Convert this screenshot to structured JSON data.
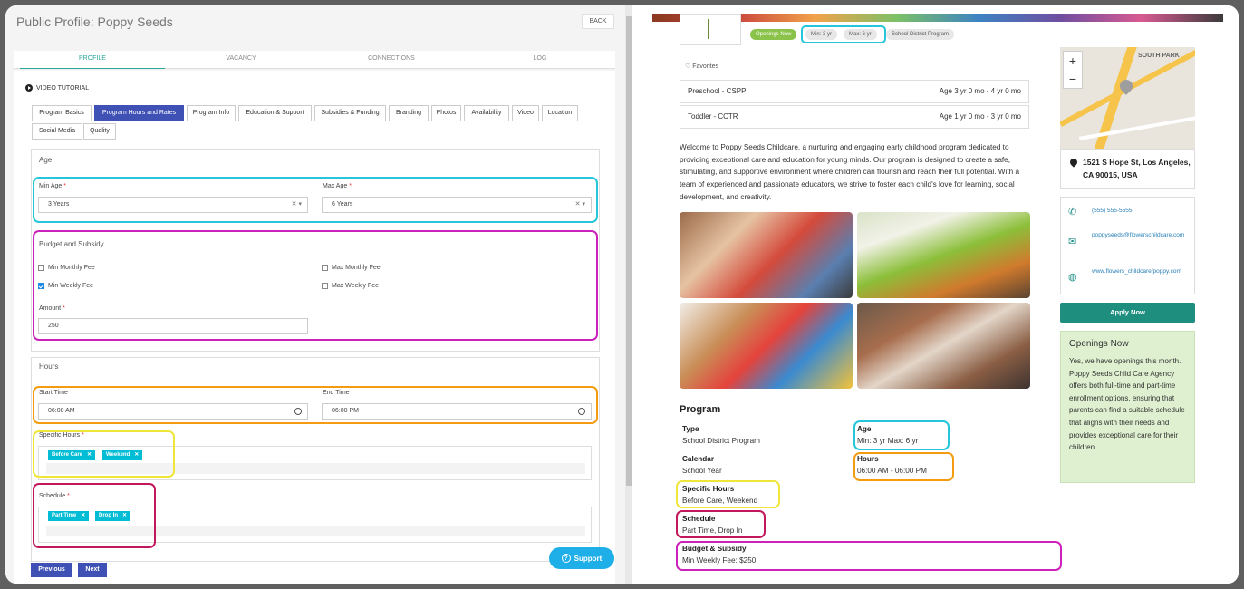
{
  "left": {
    "title": "Public Profile: Poppy Seeds",
    "back_label": "BACK",
    "tabs": [
      "PROFILE",
      "VACANCY",
      "CONNECTIONS",
      "LOG"
    ],
    "video_tutorial": "VIDEO TUTORIAL",
    "subtabs": [
      "Program Basics",
      "Program Hours and Rates",
      "Program Info",
      "Education & Support",
      "Subsidies & Funding",
      "Branding",
      "Photos",
      "Availability",
      "Video",
      "Location",
      "Social Media",
      "Quality"
    ],
    "age": {
      "heading": "Age",
      "min_label": "Min Age",
      "min_value": "3 Years",
      "max_label": "Max Age",
      "max_value": "6 Years"
    },
    "budget": {
      "heading": "Budget and Subsidy",
      "min_monthly": "Min Monthly Fee",
      "max_monthly": "Max Monthly Fee",
      "min_weekly": "Min Weekly Fee",
      "max_weekly": "Max Weekly Fee",
      "amount_label": "Amount",
      "amount_value": "250"
    },
    "hours": {
      "heading": "Hours",
      "start_label": "Start Time",
      "start_value": "06:00 AM",
      "end_label": "End Time",
      "end_value": "06:00 PM",
      "specific_label": "Specific Hours",
      "specific_tags": [
        "Before Care",
        "Weekend"
      ],
      "schedule_label": "Schedule",
      "schedule_tags": [
        "Part Time",
        "Drop In"
      ]
    },
    "required_mark": "*",
    "previous_label": "Previous",
    "next_label": "Next",
    "support_label": "Support"
  },
  "right": {
    "pills": [
      "Openings Now",
      "Min: 3 yr",
      "Max: 6 yr",
      "School District Program"
    ],
    "favorites": "Favorites",
    "programs": [
      {
        "name": "Preschool - CSPP",
        "age": "Age 3 yr 0 mo - 4 yr 0 mo"
      },
      {
        "name": "Toddler - CCTR",
        "age": "Age 1 yr 0 mo - 3 yr 0 mo"
      }
    ],
    "description": "Welcome to Poppy Seeds Childcare, a nurturing and engaging early childhood program dedicated to providing exceptional care and education for young minds. Our program is designed to create a safe, stimulating, and supportive environment where children can flourish and reach their full potential. With a team of experienced and passionate educators, we strive to foster each child's love for learning, social development, and creativity.",
    "program_title": "Program",
    "type_label": "Type",
    "type_value": "School District Program",
    "age_label": "Age",
    "age_value": "Min: 3 yr Max: 6 yr",
    "calendar_label": "Calendar",
    "calendar_value": "School Year",
    "hours_label": "Hours",
    "hours_value": "06:00 AM - 06:00 PM",
    "specific_label": "Specific Hours",
    "specific_value": "Before Care, Weekend",
    "schedule_label": "Schedule",
    "schedule_value": "Part Time, Drop In",
    "budget_label": "Budget & Subsidy",
    "budget_value": "Min Weekly Fee: $250",
    "map_label": "SOUTH PARK",
    "address": "1521 S Hope St, Los Angeles, CA 90015, USA",
    "phone": "(555) 555-5555",
    "email": "poppyseeds@flowerschildcare.com",
    "website": "www.flowers_childcare/poppy.com",
    "apply_label": "Apply Now",
    "openings_title": "Openings Now",
    "openings_text": "Yes, we have openings this month. Poppy Seeds Child Care Agency offers both full-time and part-time enrollment options, ensuring that parents can find a suitable schedule that aligns with their needs and provides exceptional care for their children."
  },
  "colors": {
    "accent_teal": "#26a69a",
    "tab_blue": "#3f51b5",
    "tag_cyan": "#00bcd4",
    "apply_green": "#1e8f7f",
    "highlight_teal": "#26c6da",
    "highlight_magenta": "#cc22bb",
    "highlight_orange": "#f39c12",
    "highlight_yellow": "#f0e63a",
    "highlight_crimson": "#c2185b"
  }
}
